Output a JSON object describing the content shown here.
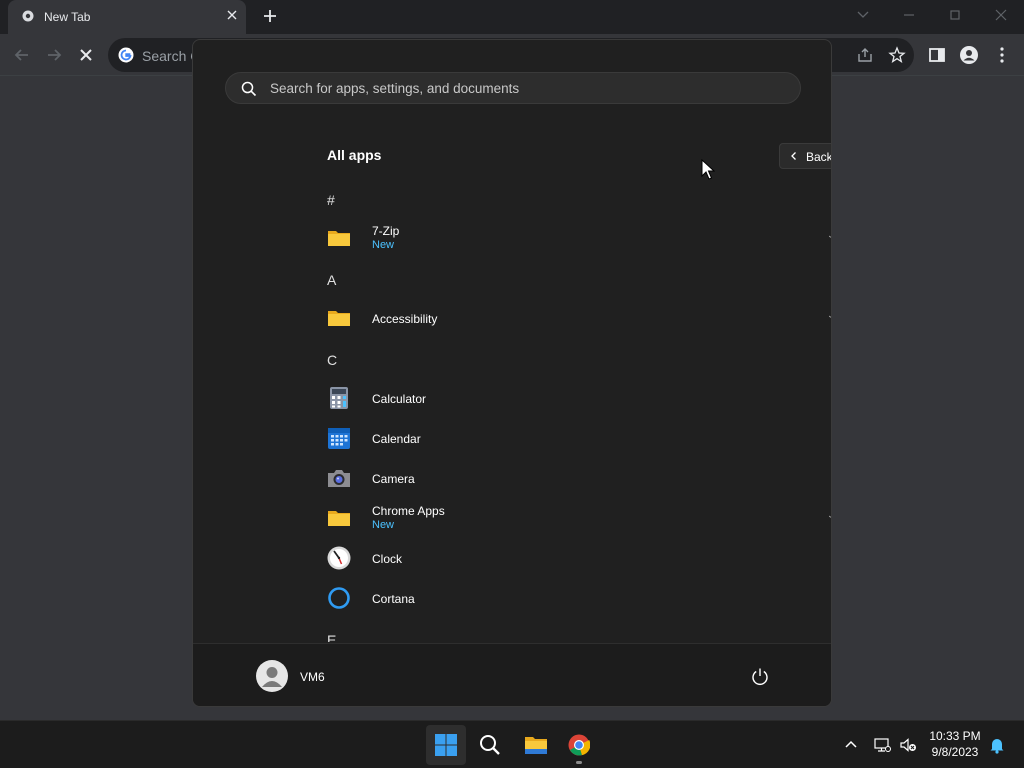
{
  "browser": {
    "tab_title": "New Tab",
    "omnibox_placeholder": "Search G"
  },
  "start_menu": {
    "search_placeholder": "Search for apps, settings, and documents",
    "heading": "All apps",
    "back_label": "Back",
    "sections": [
      {
        "letter": "#",
        "apps": [
          {
            "name": "7-Zip",
            "badge": "New",
            "icon": "folder-icon",
            "expandable": true
          }
        ]
      },
      {
        "letter": "A",
        "apps": [
          {
            "name": "Accessibility",
            "badge": "",
            "icon": "folder-icon",
            "expandable": true
          }
        ]
      },
      {
        "letter": "C",
        "apps": [
          {
            "name": "Calculator",
            "badge": "",
            "icon": "calculator-icon",
            "expandable": false
          },
          {
            "name": "Calendar",
            "badge": "",
            "icon": "calendar-icon",
            "expandable": false
          },
          {
            "name": "Camera",
            "badge": "",
            "icon": "camera-icon",
            "expandable": false
          },
          {
            "name": "Chrome Apps",
            "badge": "New",
            "icon": "folder-icon",
            "expandable": true
          },
          {
            "name": "Clock",
            "badge": "",
            "icon": "clock-icon",
            "expandable": false
          },
          {
            "name": "Cortana",
            "badge": "",
            "icon": "cortana-icon",
            "expandable": false
          }
        ]
      },
      {
        "letter": "E",
        "apps": []
      }
    ],
    "user_name": "VM6"
  },
  "taskbar": {
    "time": "10:33 PM",
    "date": "9/8/2023",
    "apps": [
      "start-icon",
      "search-icon",
      "file-explorer-icon",
      "chrome-icon"
    ]
  },
  "colors": {
    "accent": "#4cc2ff",
    "folder": "#f8c83c",
    "start_bg": "#202020",
    "taskbar_bg": "#1c1c1c"
  }
}
